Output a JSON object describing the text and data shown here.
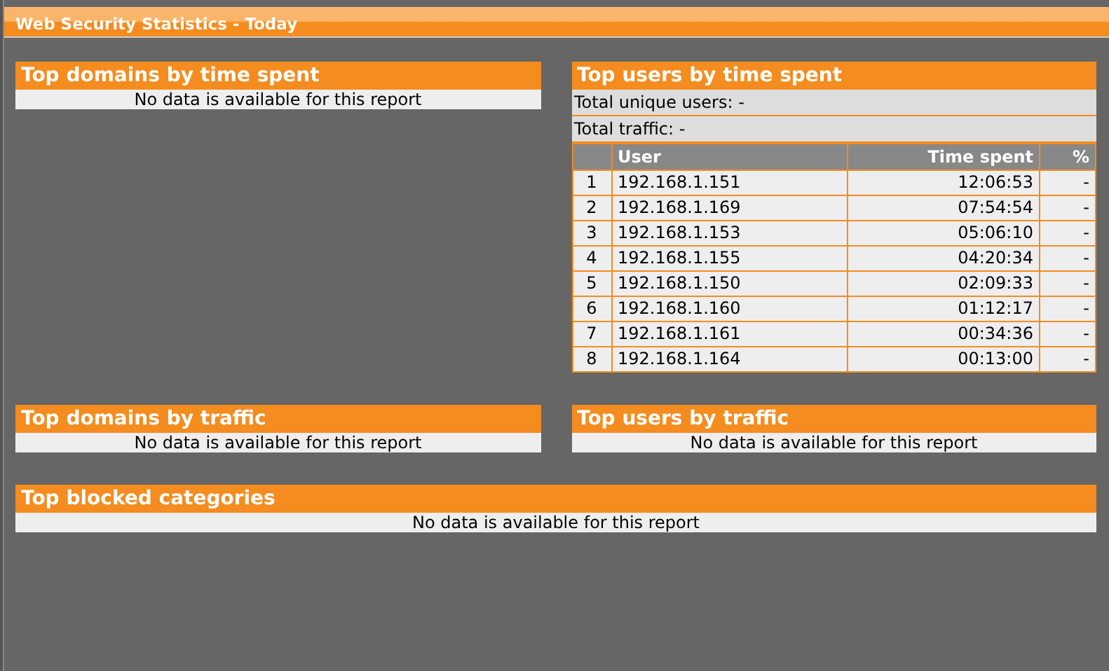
{
  "window": {
    "title": "Web Security Statistics - Today"
  },
  "panels": [
    {
      "kind": "empty",
      "title": "Top domains by time spent",
      "message": "No data is available for this report"
    },
    {
      "kind": "table",
      "title": "Top users by time spent",
      "totals": [
        "Total unique users: -",
        "Total traffic: -"
      ],
      "columns": [
        {},
        {
          "label": "User"
        },
        {
          "label": "Time spent"
        },
        {
          "label": "%"
        }
      ],
      "rows": [
        [
          "1",
          "192.168.1.151",
          "12:06:53",
          "-"
        ],
        [
          "2",
          "192.168.1.169",
          "07:54:54",
          "-"
        ],
        [
          "3",
          "192.168.1.153",
          "05:06:10",
          "-"
        ],
        [
          "4",
          "192.168.1.155",
          "04:20:34",
          "-"
        ],
        [
          "5",
          "192.168.1.150",
          "02:09:33",
          "-"
        ],
        [
          "6",
          "192.168.1.160",
          "01:12:17",
          "-"
        ],
        [
          "7",
          "192.168.1.161",
          "00:34:36",
          "-"
        ],
        [
          "8",
          "192.168.1.164",
          "00:13:00",
          "-"
        ]
      ]
    },
    {
      "kind": "empty",
      "title": "Top domains by traffic",
      "message": "No data is available for this report"
    },
    {
      "kind": "empty",
      "title": "Top users by traffic",
      "message": "No data is available for this report"
    },
    {
      "kind": "empty",
      "title": "Top blocked categories",
      "message": "No data is available for this report"
    }
  ]
}
